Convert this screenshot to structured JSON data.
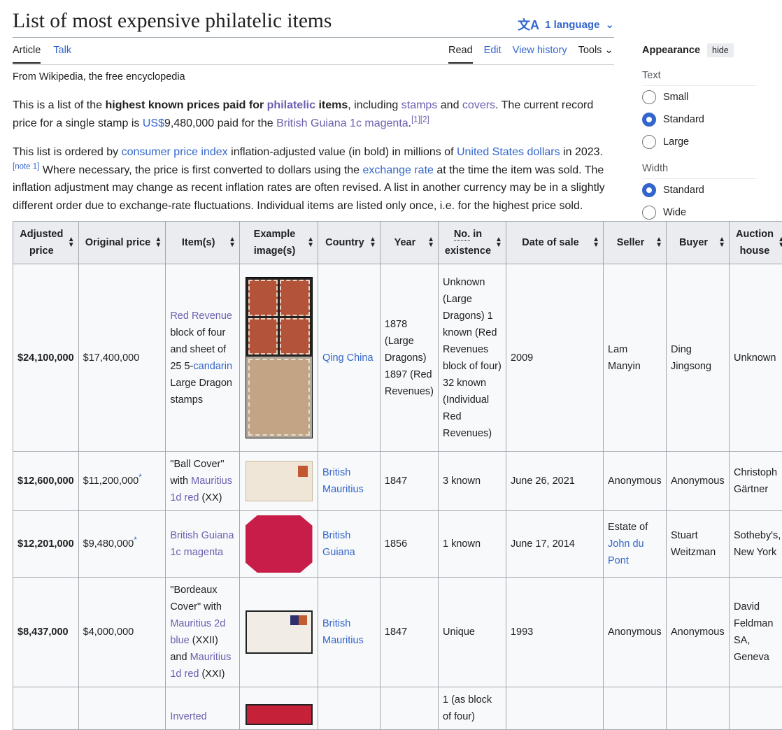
{
  "page": {
    "title": "List of most expensive philatelic items",
    "language_button": "1 language",
    "tagline": "From Wikipedia, the free encyclopedia"
  },
  "tabs": {
    "left": [
      "Article",
      "Talk"
    ],
    "right": [
      "Read",
      "Edit",
      "View history",
      "Tools"
    ]
  },
  "intro": {
    "p1": {
      "t1": "This is a list of the ",
      "b1": "highest known prices paid for ",
      "l1": "philatelic",
      "b2": " items",
      "t2": ", including ",
      "l2": "stamps",
      "t3": " and ",
      "l3": "covers",
      "t4": ". The current record price for a single stamp is ",
      "l4": "US$",
      "t5": "9,480,000 paid for the ",
      "l5": "British Guiana 1c magenta",
      "t6": ".",
      "ref": "[1][2]"
    },
    "p2": {
      "t1": "This list is ordered by ",
      "l1": "consumer price index",
      "t2": " inflation-adjusted value (in bold) in millions of ",
      "l2": "United States dollars",
      "t3": " in 2023.",
      "note": "[note 1]",
      "t4": " Where necessary, the price is first converted to dollars using the ",
      "l3": "exchange rate",
      "t5": " at the time the item was sold. The inflation adjustment may change as recent inflation rates are often revised. A list in another currency may be in a slightly different order due to exchange-rate fluctuations. Individual items are listed only once, i.e. for the highest price sold."
    }
  },
  "appearance": {
    "title": "Appearance",
    "hide": "hide",
    "text_label": "Text",
    "text_options": [
      "Small",
      "Standard",
      "Large"
    ],
    "width_label": "Width",
    "width_options": [
      "Standard",
      "Wide"
    ]
  },
  "table": {
    "headers": {
      "adjusted": "Adjusted price",
      "original": "Original price",
      "items": "Item(s)",
      "example": "Example image(s)",
      "country": "Country",
      "year": "Year",
      "no_abbr": "No.",
      "no_rest": " in existence",
      "date": "Date of sale",
      "seller": "Seller",
      "buyer": "Buyer",
      "auction": "Auction house"
    },
    "r1": {
      "adjusted": "$24,100,000",
      "original": "$17,400,000",
      "item_l1": "Red Revenue",
      "item_t1": " block of four and sheet of 25 5-",
      "item_l2": "candarin",
      "item_t2": " Large Dragon stamps",
      "country": "Qing China",
      "year": "1878 (Large Dragons) 1897 (Red Revenues)",
      "existence": "Unknown (Large Dragons) 1 known (Red Revenues block of four) 32 known (Individual Red Revenues)",
      "date": "2009",
      "seller": "Lam Manyin",
      "buyer": "Ding Jingsong",
      "auction": "Unknown"
    },
    "r2": {
      "adjusted": "$12,600,000",
      "original": "$11,200,000",
      "original_sup": "*",
      "item_t1": "\"Ball Cover\" with ",
      "item_l1": "Mauritius 1d red",
      "item_t2": " (XX)",
      "country": "British Mauritius",
      "year": "1847",
      "existence": "3 known",
      "date": "June 26, 2021",
      "seller": "Anonymous",
      "buyer": "Anonymous",
      "auction": "Christoph Gärtner"
    },
    "r3": {
      "adjusted": "$12,201,000",
      "original": "$9,480,000",
      "original_sup": "*",
      "item_l1": "British Guiana 1c magenta",
      "country": "British Guiana",
      "year": "1856",
      "existence": "1 known",
      "date": "June 17, 2014",
      "seller_t": "Estate of ",
      "seller_l": "John du Pont",
      "buyer": "Stuart Weitzman",
      "auction": "Sotheby's, New York"
    },
    "r4": {
      "adjusted": "$8,437,000",
      "original": "$4,000,000",
      "item_t1": "\"Bordeaux Cover\" with ",
      "item_l1": "Mauritius 2d blue",
      "item_t2": " (XXII) and ",
      "item_l2": "Mauritius 1d red",
      "item_t3": " (XXI)",
      "country": "British Mauritius",
      "year": "1847",
      "existence": "Unique",
      "date": "1993",
      "seller": "Anonymous",
      "buyer": "Anonymous",
      "auction": "David Feldman SA, Geneva"
    },
    "r5": {
      "item_l1": "Inverted",
      "existence": "1 (as block of four)"
    }
  }
}
